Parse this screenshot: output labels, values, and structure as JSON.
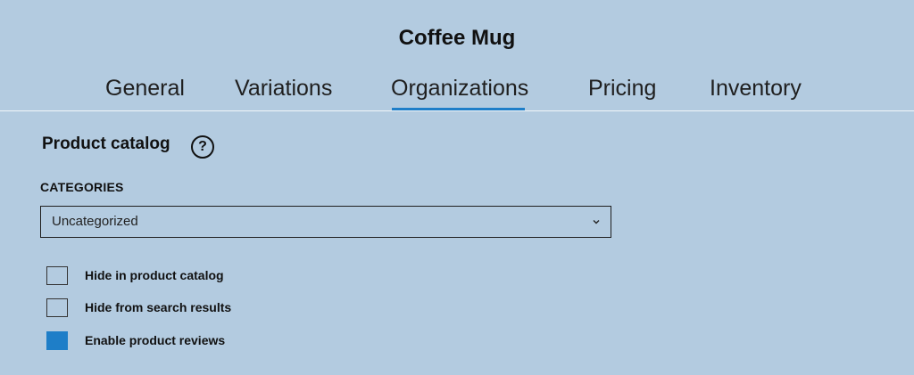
{
  "header": {
    "title": "Coffee Mug"
  },
  "tabs": [
    {
      "label": "General",
      "active": false
    },
    {
      "label": "Variations",
      "active": false
    },
    {
      "label": "Organizations",
      "active": true
    },
    {
      "label": "Pricing",
      "active": false
    },
    {
      "label": "Inventory",
      "active": false
    }
  ],
  "section": {
    "title": "Product catalog",
    "help_icon": "?"
  },
  "categories": {
    "label": "CATEGORIES",
    "selected": "Uncategorized",
    "icon": "chevron-down-icon"
  },
  "options": [
    {
      "label": "Hide in product catalog",
      "checked": false
    },
    {
      "label": "Hide from search results",
      "checked": false
    },
    {
      "label": "Enable product reviews",
      "checked": true
    }
  ],
  "colors": {
    "background": "#b3cbe0",
    "accent": "#1e7ec8",
    "text": "#111111"
  }
}
